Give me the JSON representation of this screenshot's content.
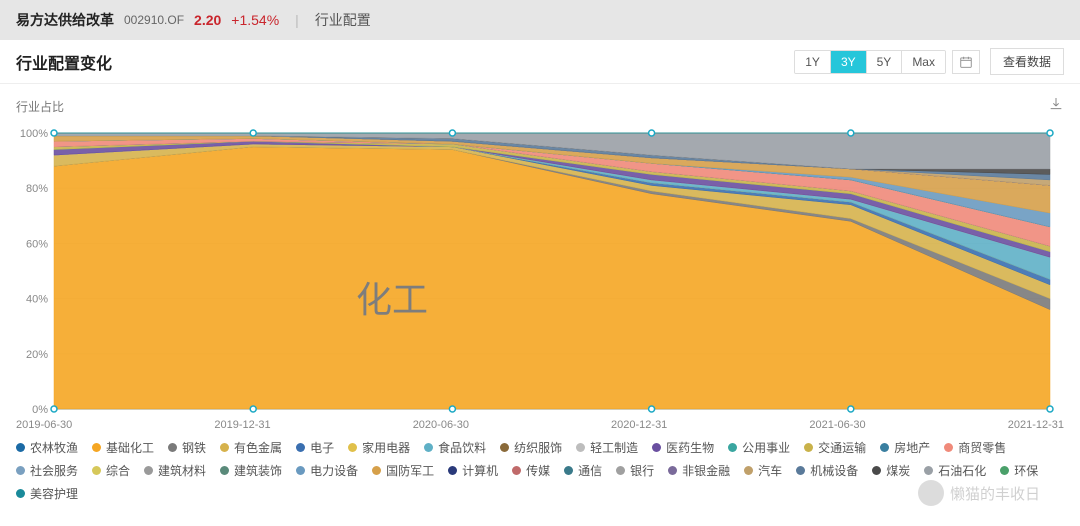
{
  "header": {
    "name": "易方达供给改革",
    "code": "002910.OF",
    "price": "2.20",
    "change": "+1.54%",
    "tab": "行业配置"
  },
  "subbar": {
    "title": "行业配置变化",
    "ranges": [
      "1Y",
      "3Y",
      "5Y",
      "Max"
    ],
    "active_range": "3Y",
    "view_data_label": "查看数据"
  },
  "chart": {
    "ylabel": "行业占比",
    "overlay": "化工",
    "watermark": "懒猫的丰收日",
    "yticks": [
      "0%",
      "20%",
      "40%",
      "60%",
      "80%",
      "100%"
    ],
    "xticks": [
      "2019-06-30",
      "2019-12-31",
      "2020-06-30",
      "2020-12-31",
      "2021-06-30",
      "2021-12-31"
    ]
  },
  "legend": {
    "items": [
      {
        "label": "农林牧渔",
        "color": "#1b6aa5"
      },
      {
        "label": "基础化工",
        "color": "#f5a623"
      },
      {
        "label": "钢铁",
        "color": "#7a7a7a"
      },
      {
        "label": "有色金属",
        "color": "#d6b24c"
      },
      {
        "label": "电子",
        "color": "#3a6fb0"
      },
      {
        "label": "家用电器",
        "color": "#e0c04a"
      },
      {
        "label": "食品饮料",
        "color": "#5fb0c6"
      },
      {
        "label": "纺织服饰",
        "color": "#8a6a3a"
      },
      {
        "label": "轻工制造",
        "color": "#bdbdbd"
      },
      {
        "label": "医药生物",
        "color": "#6a4fa0"
      },
      {
        "label": "公用事业",
        "color": "#3aa6a0"
      },
      {
        "label": "交通运输",
        "color": "#c9b24a"
      },
      {
        "label": "房地产",
        "color": "#3a7fa0"
      },
      {
        "label": "商贸零售",
        "color": "#f08a7a"
      },
      {
        "label": "社会服务",
        "color": "#7aa0c0"
      },
      {
        "label": "综合",
        "color": "#d6c85a"
      },
      {
        "label": "建筑材料",
        "color": "#9a9a9a"
      },
      {
        "label": "建筑装饰",
        "color": "#5a8a7a"
      },
      {
        "label": "电力设备",
        "color": "#6a9ac0"
      },
      {
        "label": "国防军工",
        "color": "#d6a04a"
      },
      {
        "label": "计算机",
        "color": "#2a3a7a"
      },
      {
        "label": "传媒",
        "color": "#c06a6a"
      },
      {
        "label": "通信",
        "color": "#3a7a8a"
      },
      {
        "label": "银行",
        "color": "#a0a0a0"
      },
      {
        "label": "非银金融",
        "color": "#7a6a9a"
      },
      {
        "label": "汽车",
        "color": "#c0a06a"
      },
      {
        "label": "机械设备",
        "color": "#5a7a9a"
      },
      {
        "label": "煤炭",
        "color": "#4a4a4a"
      },
      {
        "label": "石油石化",
        "color": "#9aa0a6"
      },
      {
        "label": "环保",
        "color": "#4aa06a"
      },
      {
        "label": "美容护理",
        "color": "#1a8a9a"
      }
    ]
  },
  "chart_data": {
    "type": "area",
    "stacked": true,
    "title": "行业配置变化",
    "ylabel": "行业占比",
    "xlabel": "",
    "ylim": [
      0,
      100
    ],
    "x": [
      "2019-06-30",
      "2019-12-31",
      "2020-06-30",
      "2020-12-31",
      "2021-06-30",
      "2021-12-31"
    ],
    "note": "Values are approximate percentage shares read from the stacked-area chart; each column sums to ≈100. 基础化工 (orange) is the dominant holding, shrinking from ~88% to ~36% while many small sectors grow. Series with all zeros appear in the legend but have no visible area at these dates.",
    "series": [
      {
        "name": "农林牧渔",
        "values": [
          0,
          0,
          0,
          0,
          0,
          0
        ]
      },
      {
        "name": "基础化工",
        "values": [
          88,
          95,
          94,
          78,
          68,
          36
        ]
      },
      {
        "name": "钢铁",
        "values": [
          0,
          0,
          0,
          1,
          1,
          4
        ]
      },
      {
        "name": "有色金属",
        "values": [
          4,
          1,
          1,
          2,
          5,
          5
        ]
      },
      {
        "name": "电子",
        "values": [
          0,
          0,
          0,
          1,
          1,
          2
        ]
      },
      {
        "name": "家用电器",
        "values": [
          0,
          0,
          0,
          0,
          0,
          0
        ]
      },
      {
        "name": "食品饮料",
        "values": [
          0,
          0,
          0,
          1,
          1,
          8
        ]
      },
      {
        "name": "纺织服饰",
        "values": [
          0,
          0,
          0,
          0,
          0,
          0
        ]
      },
      {
        "name": "轻工制造",
        "values": [
          0,
          0,
          0,
          0,
          0,
          0
        ]
      },
      {
        "name": "医药生物",
        "values": [
          2,
          1,
          0,
          2,
          2,
          2
        ]
      },
      {
        "name": "公用事业",
        "values": [
          0,
          0,
          0,
          0,
          0,
          0
        ]
      },
      {
        "name": "交通运输",
        "values": [
          1,
          0,
          1,
          1,
          1,
          2
        ]
      },
      {
        "name": "房地产",
        "values": [
          0,
          0,
          0,
          0,
          0,
          0
        ]
      },
      {
        "name": "商贸零售",
        "values": [
          2,
          1,
          0,
          3,
          4,
          7
        ]
      },
      {
        "name": "社会服务",
        "values": [
          0,
          0,
          0,
          0,
          0,
          0
        ]
      },
      {
        "name": "综合",
        "values": [
          0,
          0,
          0,
          0,
          0,
          0
        ]
      },
      {
        "name": "建筑材料",
        "values": [
          0,
          0,
          0,
          0,
          0,
          0
        ]
      },
      {
        "name": "建筑装饰",
        "values": [
          0,
          0,
          0,
          0,
          0,
          0
        ]
      },
      {
        "name": "电力设备",
        "values": [
          0,
          0,
          0,
          0,
          1,
          5
        ]
      },
      {
        "name": "国防军工",
        "values": [
          2,
          1,
          1,
          2,
          3,
          10
        ]
      },
      {
        "name": "计算机",
        "values": [
          0,
          0,
          0,
          0,
          0,
          0
        ]
      },
      {
        "name": "传媒",
        "values": [
          0,
          0,
          0,
          0,
          0,
          0
        ]
      },
      {
        "name": "通信",
        "values": [
          0,
          0,
          0,
          0,
          0,
          0
        ]
      },
      {
        "name": "银行",
        "values": [
          0,
          0,
          0,
          0,
          0,
          0
        ]
      },
      {
        "name": "非银金融",
        "values": [
          0,
          0,
          0,
          0,
          0,
          0
        ]
      },
      {
        "name": "汽车",
        "values": [
          0,
          0,
          0,
          0,
          0,
          2
        ]
      },
      {
        "name": "机械设备",
        "values": [
          0,
          0,
          1,
          1,
          0,
          2
        ]
      },
      {
        "name": "煤炭",
        "values": [
          0,
          0,
          0,
          0,
          0,
          2
        ]
      },
      {
        "name": "石油石化",
        "values": [
          1,
          1,
          2,
          8,
          13,
          13
        ]
      },
      {
        "name": "环保",
        "values": [
          0,
          0,
          0,
          0,
          0,
          0
        ]
      },
      {
        "name": "美容护理",
        "values": [
          0,
          0,
          0,
          0,
          0,
          0
        ]
      }
    ]
  }
}
